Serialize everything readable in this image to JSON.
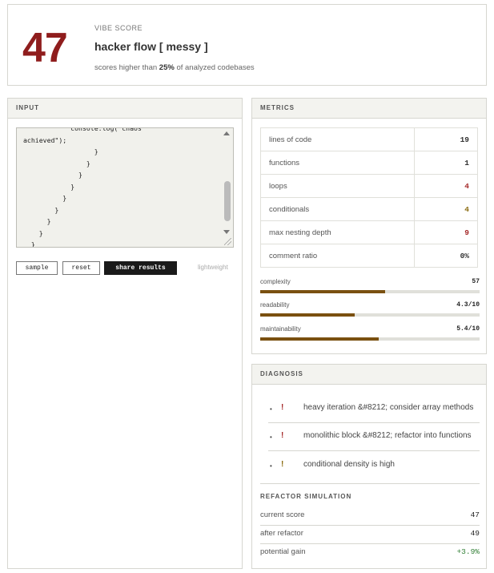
{
  "header": {
    "score": "47",
    "label": "vibe score",
    "title": "hacker flow [ messy ]",
    "subtitle_prefix": "scores higher than ",
    "subtitle_percent": "25%",
    "subtitle_suffix": " of analyzed codebases",
    "score_color": "#8f1d1d"
  },
  "input": {
    "heading": "input",
    "code": "            console.log(\"chaos\nachieved\");\n                  }\n                }\n              }\n            }\n          }\n        }\n      }\n    }\n  }\n}",
    "buttons": {
      "sample": "sample",
      "reset": "reset",
      "share": "share results"
    },
    "weight_label": "lightweight"
  },
  "metrics": {
    "heading": "metrics",
    "rows": [
      {
        "label": "lines of code",
        "value": "19",
        "color": "#333333"
      },
      {
        "label": "functions",
        "value": "1",
        "color": "#333333"
      },
      {
        "label": "loops",
        "value": "4",
        "color": "#a52a2a"
      },
      {
        "label": "conditionals",
        "value": "4",
        "color": "#8b6b10"
      },
      {
        "label": "max nesting depth",
        "value": "9",
        "color": "#a52a2a"
      },
      {
        "label": "comment ratio",
        "value": "0%",
        "color": "#333333"
      }
    ],
    "bars": [
      {
        "label": "complexity",
        "value": "57",
        "fraction": 0.57
      },
      {
        "label": "readability",
        "value": "4.3/10",
        "fraction": 0.43
      },
      {
        "label": "maintainability",
        "value": "5.4/10",
        "fraction": 0.54
      }
    ],
    "bar_color": "#7a5010"
  },
  "diagnosis": {
    "heading": "diagnosis",
    "items": [
      {
        "mark": "!",
        "text": "heavy iteration &#8212; consider array methods",
        "color": "#a52a2a"
      },
      {
        "mark": "!",
        "text": "monolithic block &#8212; refactor into functions",
        "color": "#a52a2a"
      },
      {
        "mark": "!",
        "text": "conditional density is high",
        "color": "#8b6b10"
      }
    ],
    "refactor": {
      "heading": "refactor simulation",
      "rows": [
        {
          "label": "current score",
          "value": "47",
          "color": "#222222"
        },
        {
          "label": "after refactor",
          "value": "49",
          "color": "#222222"
        },
        {
          "label": "potential gain",
          "value": "+3.9%",
          "color": "#2e7d32"
        }
      ]
    }
  }
}
